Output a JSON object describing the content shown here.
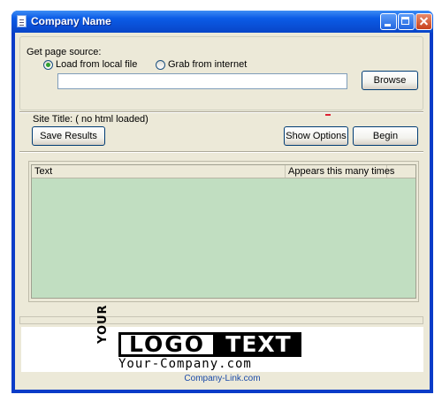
{
  "window": {
    "title": "Company Name"
  },
  "source_group": {
    "label": "Get page source:",
    "radio_local": {
      "label": "Load from local file",
      "checked": true
    },
    "radio_internet": {
      "label": "Grab from internet",
      "checked": false
    },
    "path_value": "",
    "browse_label": "Browse"
  },
  "site_title": "Site Title: ( no html loaded)",
  "buttons": {
    "save_results": "Save Results",
    "show_options": "Show Options",
    "begin": "Begin"
  },
  "table": {
    "columns": [
      "Text",
      "Appears this many times"
    ],
    "rows": [],
    "background": "#c1dec1"
  },
  "banner": {
    "your": "YOUR",
    "logo": "LOGO",
    "text": "TEXT",
    "company": "Your-Company.com",
    "link": "Company-Link.com"
  },
  "colors": {
    "titlebar": "#0b5ce6",
    "client": "#ece9d8",
    "link": "#1a4aa8"
  }
}
